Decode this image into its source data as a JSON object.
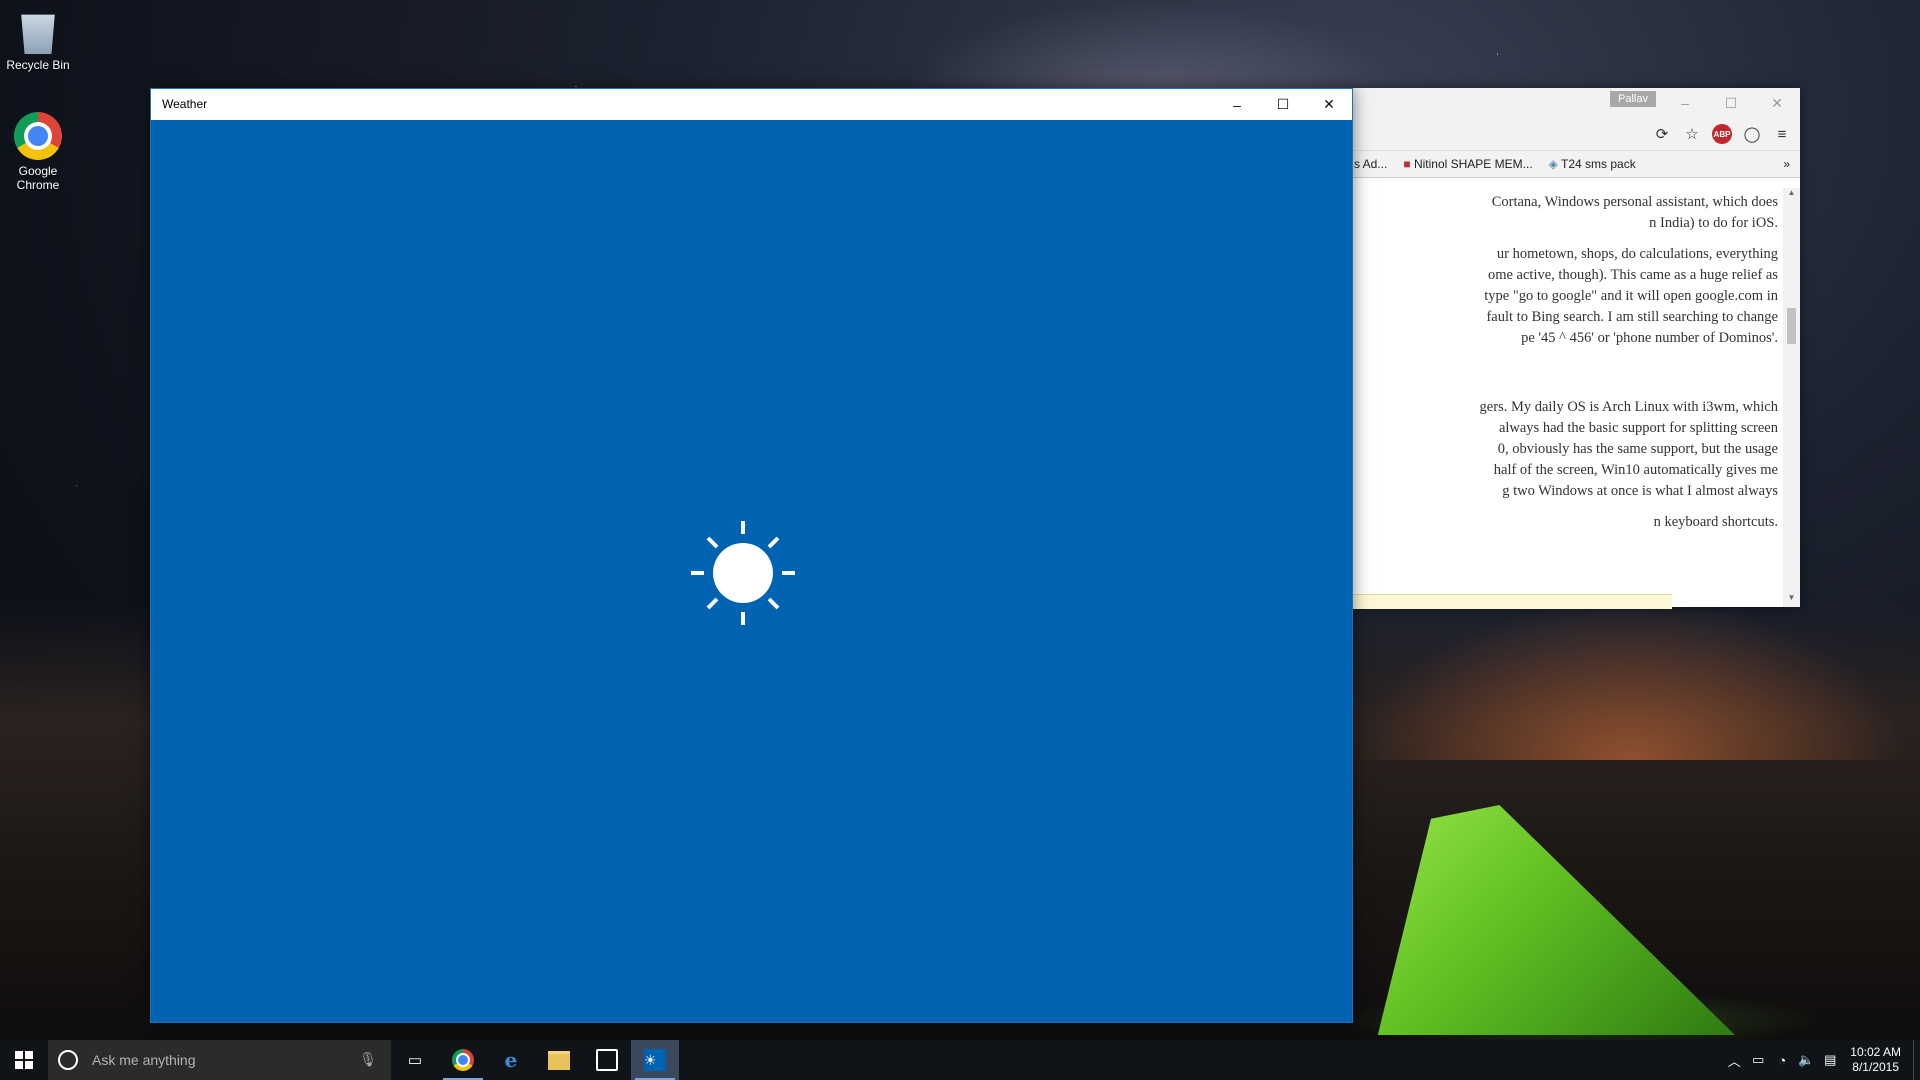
{
  "desktop": {
    "icons": [
      {
        "label": "Recycle Bin"
      },
      {
        "label": "Google Chrome"
      }
    ]
  },
  "weather_window": {
    "title": "Weather",
    "minimize": "–",
    "maximize": "☐",
    "close": "✕",
    "splash_icon": "sun-icon",
    "background_color": "#0063b1"
  },
  "chrome_window": {
    "profile_name": "Pallav",
    "bookmarks": [
      {
        "label": "s Ad..."
      },
      {
        "label": "Nitinol SHAPE MEM..."
      },
      {
        "label": "T24 sms pack"
      }
    ],
    "bookmarks_overflow": "»",
    "paragraphs": [
      [
        "Cortana, Windows personal assistant, which does",
        "n India) to do for iOS."
      ],
      [
        "ur hometown, shops, do calculations, everything",
        "ome active, though). This came as a huge relief as",
        "type \"go to google\" and it will open google.com in",
        "fault to Bing search. I am still searching to change",
        "pe '45 ^ 456' or 'phone number of Dominos'."
      ],
      [
        "gers. My daily OS is Arch Linux with i3wm, which",
        "always had the basic support for splitting screen",
        "0, obviously has the same support, but the usage",
        "half of the screen, Win10 automatically gives me",
        "g two Windows at once is what I almost always"
      ],
      [
        "n keyboard shortcuts."
      ]
    ]
  },
  "taskbar": {
    "search_placeholder": "Ask me anything",
    "apps": [
      "task-view",
      "google-chrome",
      "edge",
      "file-explorer",
      "store",
      "weather"
    ],
    "clock_time": "10:02 AM",
    "clock_date": "8/1/2015"
  }
}
